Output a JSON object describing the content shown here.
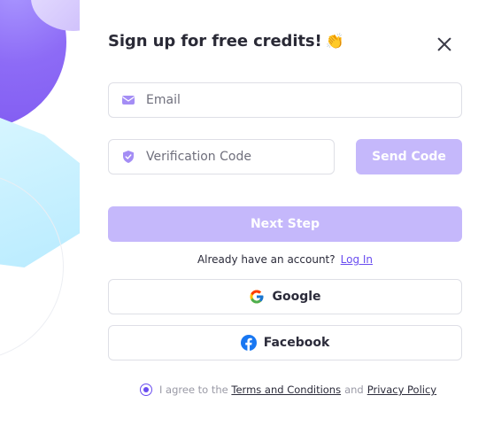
{
  "header": {
    "title": "Sign up for free credits!",
    "title_emoji": "👏"
  },
  "icons": {
    "close": "close-icon",
    "email": "envelope-icon",
    "verification": "shield-check-icon",
    "google": "google-logo-icon",
    "facebook": "facebook-logo-icon"
  },
  "form": {
    "email": {
      "placeholder": "Email",
      "value": ""
    },
    "verification": {
      "placeholder": "Verification Code",
      "value": ""
    },
    "send_code_label": "Send Code",
    "next_step_label": "Next Step"
  },
  "account": {
    "prompt": "Already have an account?",
    "login_label": "Log In"
  },
  "social": {
    "google_label": "Google",
    "facebook_label": "Facebook"
  },
  "agreement": {
    "prefix": "I agree to the",
    "terms_label": "Terms and Conditions",
    "joiner": "and",
    "privacy_label": "Privacy Policy",
    "checked": true
  },
  "colors": {
    "accent": "#6a4df0",
    "button_disabled": "#c5b8fb",
    "border": "#dedfe6",
    "text": "#2b2b3a",
    "muted": "#9a9aa6"
  }
}
